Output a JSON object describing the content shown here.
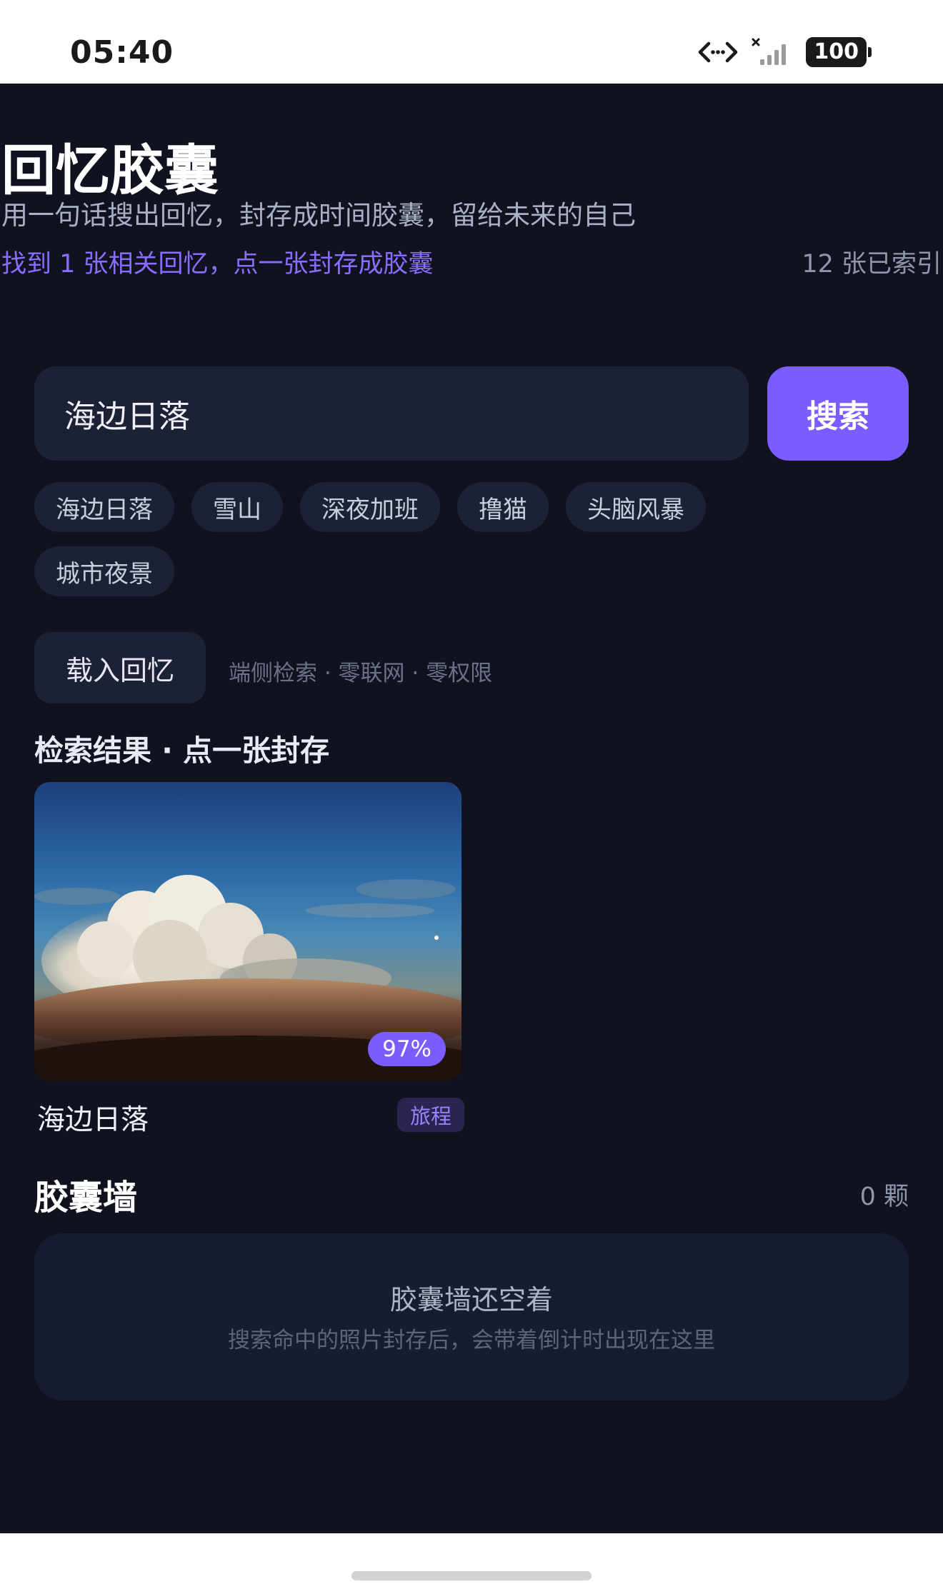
{
  "status_bar": {
    "time": "05:40",
    "battery": "100",
    "icons": [
      "data-transfer-icon",
      "no-signal-icon",
      "battery-icon"
    ]
  },
  "header": {
    "title": "回忆胶囊",
    "subtitle": "用一句话搜出回忆，封存成时间胶囊，留给未来的自己",
    "result_hint": "找到 1 张相关回忆，点一张封存成胶囊",
    "index_count": "12 张已索引"
  },
  "search": {
    "value": "海边日落",
    "button_label": "搜索"
  },
  "chips": [
    "海边日落",
    "雪山",
    "深夜加班",
    "撸猫",
    "头脑风暴",
    "城市夜景"
  ],
  "actions": {
    "load_label": "载入回忆",
    "privacy_note": "端侧检索 · 零联网 · 零权限"
  },
  "results": {
    "heading": "检索结果 · 点一张封存",
    "items": [
      {
        "title": "海边日落",
        "tag": "旅程",
        "match": "97%"
      }
    ]
  },
  "wall": {
    "heading": "胶囊墙",
    "count": "0 颗",
    "empty_title": "胶囊墙还空着",
    "empty_desc": "搜索命中的照片封存后，会带着倒计时出现在这里"
  },
  "colors": {
    "background": "#10131f",
    "surface": "#1c2136",
    "accent": "#7c5cff",
    "accent_text": "#8a6dff"
  }
}
